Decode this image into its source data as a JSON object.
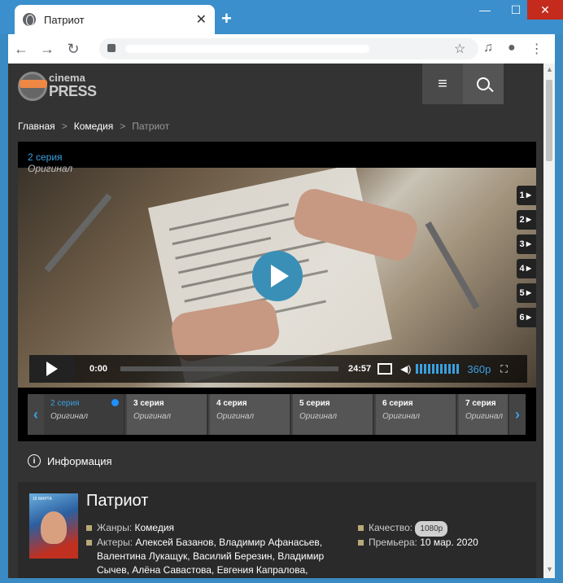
{
  "browser": {
    "tab_title": "Патриот",
    "new_tab": "+",
    "win_min": "—",
    "win_max": "☐",
    "win_close": "✕",
    "back": "←",
    "forward": "→",
    "reload": "↻",
    "star": "☆",
    "tab_close": "✕"
  },
  "header": {
    "logo_top": "cinema",
    "logo_bottom": "PRESS",
    "menu_icon": "≡"
  },
  "breadcrumb": {
    "home": "Главная",
    "category": "Комедия",
    "current": "Патриот",
    "sep": ">"
  },
  "player": {
    "series_label": "2 серия",
    "voice_label": "Оригинал",
    "time_current": "0:00",
    "time_duration": "24:57",
    "quality": "360p",
    "side_episodes": [
      "1►",
      "2►",
      "3►",
      "4►",
      "5►",
      "6►"
    ],
    "episodes": [
      {
        "name": "2 серия",
        "voice": "Оригинал",
        "active": true
      },
      {
        "name": "3 серия",
        "voice": "Оригинал",
        "active": false
      },
      {
        "name": "4 серия",
        "voice": "Оригинал",
        "active": false
      },
      {
        "name": "5 серия",
        "voice": "Оригинал",
        "active": false
      },
      {
        "name": "6 серия",
        "voice": "Оригинал",
        "active": false
      },
      {
        "name": "7 серия",
        "voice": "Оригинал",
        "active": false
      }
    ],
    "prev_arrow": "‹",
    "next_arrow": "›"
  },
  "info": {
    "heading": "Информация",
    "icon": "i"
  },
  "movie": {
    "title": "Патриот",
    "genres_label": "Жанры:",
    "genres": "Комедия",
    "actors_label": "Актеры:",
    "actors_line1": "Алексей Базанов, Владимир Афанасьев,",
    "actors_line2": "Валентина Лукащук, Василий Березин, Владимир",
    "actors_line3": "Сычев, Алёна Савастова, Евгения Капралова,",
    "quality_label": "Качество:",
    "quality_value": "1080p",
    "premiere_label": "Премьера:",
    "premiere_value": "10 мар. 2020",
    "poster_tag": "16 МАРТА"
  }
}
